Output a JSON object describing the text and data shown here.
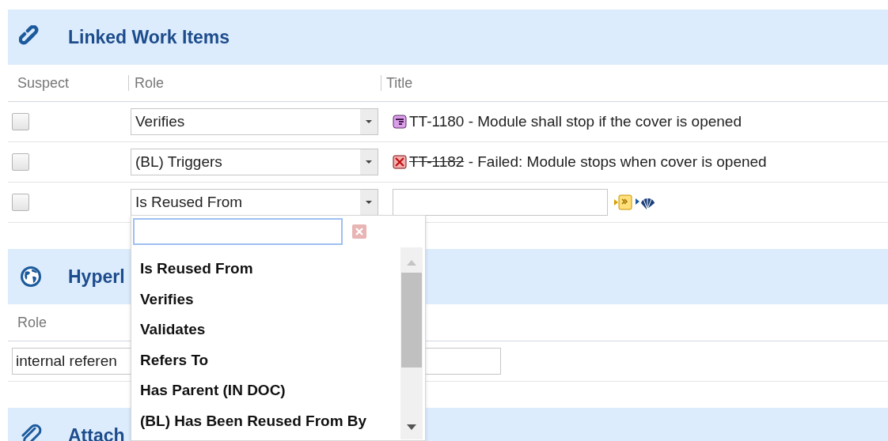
{
  "linked_work_items": {
    "title": "Linked Work Items",
    "columns": [
      "Suspect",
      "Role",
      "Title"
    ],
    "rows": [
      {
        "kind": "item",
        "suspect": false,
        "role": "Verifies",
        "item": {
          "kind": "requirement",
          "id": "TT-1180",
          "summary": " - Module shall stop if the cover is opened",
          "struck": false
        }
      },
      {
        "kind": "item",
        "suspect": false,
        "role": "(BL) Triggers",
        "item": {
          "kind": "failed",
          "id": "TT-1182",
          "summary": " - Failed: Module stops when cover is opened",
          "struck": true
        }
      },
      {
        "kind": "new",
        "suspect": false,
        "role": "Is Reused From"
      }
    ]
  },
  "hyperlinks": {
    "title": "Hyperl",
    "columns": [
      "Role"
    ],
    "rows": [
      {
        "role": "internal referen"
      }
    ]
  },
  "attachments": {
    "title": "Attach"
  },
  "role_dropdown": {
    "items": [
      "Is Reused From",
      "Verifies",
      "Validates",
      "Refers To",
      "Has Parent (IN DOC)",
      "(BL) Has Been Reused From By"
    ]
  }
}
